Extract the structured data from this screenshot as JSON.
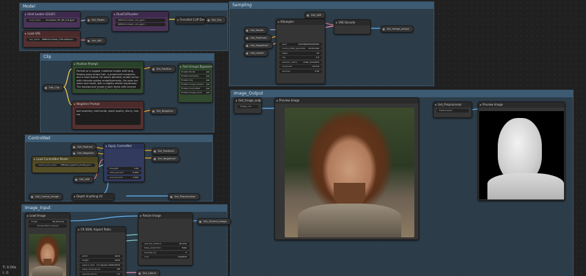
{
  "groups": {
    "model": "Model",
    "sampling": "Sampling",
    "clip": "Clip",
    "image_output": "Image_Output",
    "controlnet": "ControlNet",
    "image_input": "Image_Input"
  },
  "nodes": {
    "ckpt_loader": {
      "title": "Unet Loader (GGUF)",
      "widget_label": "unet_name",
      "widget_value": "bonsaiden_FR_Q8_0_N.gguf"
    },
    "dual_clip": {
      "title": "DualCLIPLoader",
      "w1": "6DBLfrmodelen_clip_gguf...",
      "w2": "6DBLfrmodelen_clip_gguf..."
    },
    "vae_loader": {
      "title": "Load VAE",
      "widget_label": "vae_name",
      "widget_value": "6DBLfrmodelen_F16.safetens..."
    },
    "force_clip": "ForceSet CLIP Device",
    "ksampler": {
      "title": "KSampler",
      "inputs": [
        "Get_Model",
        "Get_PositiveC",
        "Get_NegativeC",
        "Get_Latent"
      ],
      "widgets": [
        {
          "label": "seed",
          "value": "1023480431240394"
        },
        {
          "label": "control_after_generate",
          "value": "randomize"
        },
        {
          "label": "steps",
          "value": "20"
        },
        {
          "label": "cfg",
          "value": "3.0"
        },
        {
          "label": "sampler_name",
          "value": "euler_ancestral"
        },
        {
          "label": "scheduler",
          "value": "normal"
        },
        {
          "label": "denoise",
          "value": "1.00"
        }
      ]
    },
    "vae_decode": "VAE Decode",
    "positive_prompt": {
      "title": "Positive Prompt",
      "text": "Portrait of a rugged, medieval knight with long, flowing wavy brown hair, a prominent mustache, and a short beard. He wears detailed, ornate armor with intricate golden embellishments. His eyes are warm and hazel, with a slightly wistful expression. The background shows a dark forest with blurred greenery and soft light filtering through, creating a dramatic and atmospheric mood."
    },
    "negative_prompt": {
      "title": "Negative Prompt",
      "text": "bad anatomy, bad hands, worst quality, blurry, low-res"
    },
    "fast_groups": {
      "title": "Fast Groups Bypasser (rgthree)",
      "rows": [
        {
          "label": "Enable Model",
          "value": "yes"
        },
        {
          "label": "Enable Sampling",
          "value": "yes"
        },
        {
          "label": "Enable Clip",
          "value": "yes"
        },
        {
          "label": "Enable Image_Output",
          "value": "yes"
        },
        {
          "label": "Enable ControlNet",
          "value": "yes"
        },
        {
          "label": "Enable Image_Input",
          "value": "yes"
        }
      ]
    },
    "apply_controlnet": {
      "title": "Apply ControlNet",
      "inputs": [
        "Get_Positive",
        "Get_Negative",
        "Get_VAE"
      ],
      "widgets": [
        {
          "label": "strength",
          "value": "1.00"
        },
        {
          "label": "start_percent",
          "value": "0.000"
        },
        {
          "label": "end_percent",
          "value": "1.000"
        }
      ]
    },
    "controlnet_loader": {
      "title": "Load ControlNet Model",
      "widget_label": "control_net_name",
      "widget_value": "diffusion_pytorch_model_pro..."
    },
    "get_control_image": "Get_Control_Image",
    "depth_anything": "Depth Anything V2",
    "load_image": {
      "title": "Load Image",
      "widget_label": "image",
      "widget_value": "00_bsk.png",
      "button": "choose file to upload"
    },
    "sd35_ratio": {
      "title": "CR SDXL Aspect Ratio",
      "widgets": [
        {
          "label": "width",
          "value": "1024"
        },
        {
          "label": "height",
          "value": "1024"
        },
        {
          "label": "aspect_ratio",
          "value": "1:1 square 1024x1024"
        },
        {
          "label": "swap_dimensions",
          "value": "Off"
        },
        {
          "label": "upscale_factor",
          "value": "1.0"
        },
        {
          "label": "batch_size",
          "value": "1"
        }
      ]
    },
    "resize_image": {
      "title": "Resize Image",
      "widgets": [
        {
          "label": "upscale_method",
          "value": "lanczos"
        },
        {
          "label": "keep_proportion",
          "value": "false"
        },
        {
          "label": "divisible_by",
          "value": "2"
        },
        {
          "label": "crop",
          "value": "disabled"
        }
      ]
    },
    "preview1": {
      "title": "Preview Image",
      "input": "Get_Image_output"
    },
    "preview2": {
      "title": "Preview Image",
      "input": "Get_Preprocessor"
    }
  },
  "pills": {
    "set_model": "Set_Model",
    "set_clip": "Set_Clip",
    "set_vae": "Set_VAE",
    "get_vae_top": "Get_VAE",
    "set_image_output": "Set_Image_output",
    "get_clip": "Get_Clip",
    "set_positive": "Set_Positive",
    "set_negative": "Set_Negative",
    "get_positive": "Get_Positive",
    "get_negative": "Get_Negative",
    "set_positive_c": "Set_PositiveC",
    "set_negative_c": "Set_NegativeC",
    "set_preprocessor": "Set_Preprocessor",
    "set_control_image": "Set_Control_Image",
    "set_latent": "Set_Latent",
    "get_image_output": "Get_Image_output",
    "image_output_value": "Image_out...",
    "get_preprocessor": "Get_Preprocessor",
    "preprocessor_value": "Preprocessor"
  },
  "status": {
    "line1": "T: 0.00s",
    "line2": "I: 0"
  }
}
